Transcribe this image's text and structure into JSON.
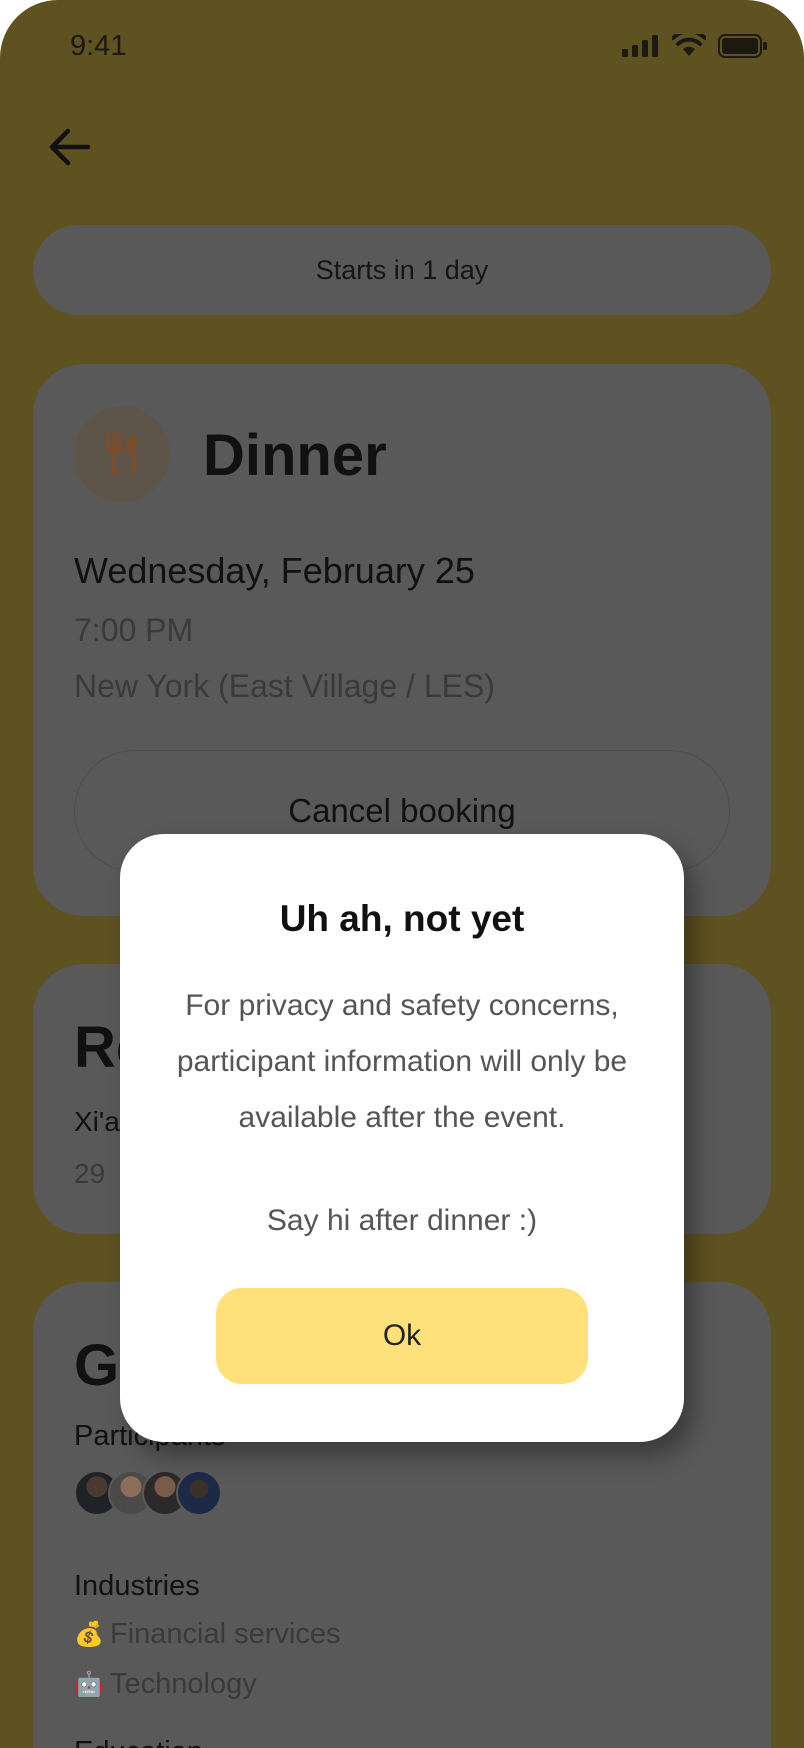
{
  "status_bar": {
    "time": "9:41"
  },
  "countdown": {
    "label": "Starts in 1 day"
  },
  "event": {
    "title": "Dinner",
    "date": "Wednesday, February 25",
    "time": "7:00 PM",
    "location": "New York (East Village / LES)",
    "cancel_label": "Cancel booking",
    "icon": "fork-knife-icon"
  },
  "review": {
    "title": "Re",
    "name": "Xi'a",
    "age": "29"
  },
  "guests": {
    "title": "G",
    "participants_label": "Participants",
    "industries_label": "Industries",
    "industries": [
      {
        "emoji": "💰",
        "label": "Financial services"
      },
      {
        "emoji": "🤖",
        "label": "Technology"
      }
    ],
    "education_label": "Education"
  },
  "modal": {
    "title": "Uh ah, not yet",
    "body": "For privacy and safety concerns, participant information will only be available after the event.",
    "hint": "Say hi after dinner :)",
    "ok_label": "Ok"
  },
  "colors": {
    "overlay_background": "#5e5221",
    "card": "#595959",
    "ok_button": "#fee17a",
    "modal": "#ffffff"
  }
}
